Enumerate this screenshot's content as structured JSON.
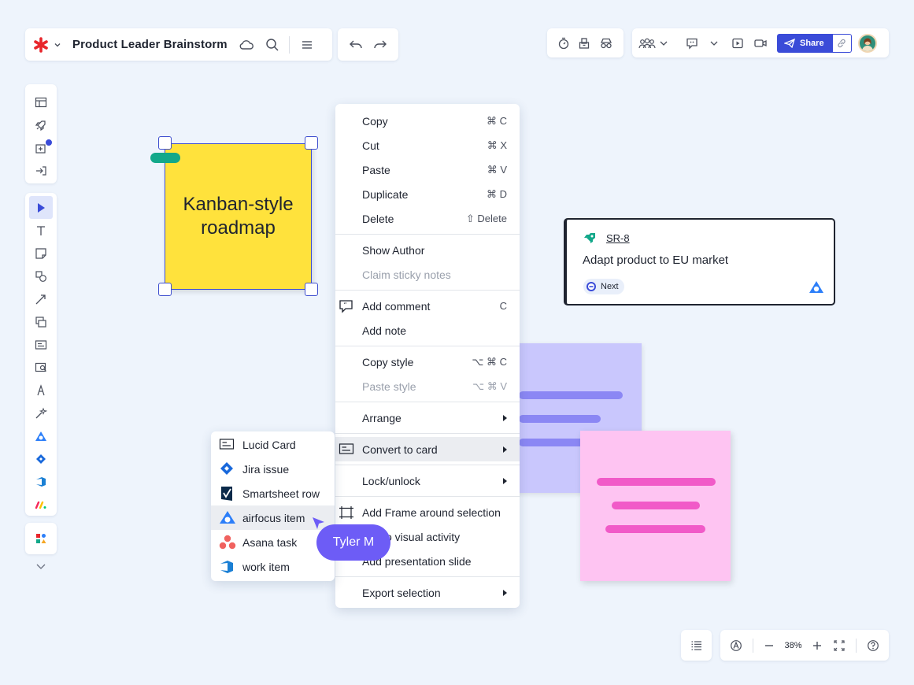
{
  "doc": {
    "title": "Product Leader Brainstorm"
  },
  "share": {
    "label": "Share"
  },
  "canvas": {
    "yellow_note": {
      "text": "Kanban-style roadmap",
      "color": "#ffe23c"
    },
    "lavender_note": {
      "color": "#c9c7fd"
    },
    "pink_note": {
      "color": "#fec4f2"
    },
    "airfocus_card": {
      "key": "SR-8",
      "title": "Adapt product to EU market",
      "status": "Next"
    }
  },
  "context_menu": {
    "items": [
      {
        "label": "Copy",
        "shortcut": "⌘ C"
      },
      {
        "label": "Cut",
        "shortcut": "⌘ X"
      },
      {
        "label": "Paste",
        "shortcut": "⌘ V"
      },
      {
        "label": "Duplicate",
        "shortcut": "⌘ D"
      },
      {
        "label": "Delete",
        "shortcut": "⇧ Delete"
      },
      {
        "label": "Show Author"
      },
      {
        "label": "Claim sticky notes"
      },
      {
        "label": "Add comment",
        "shortcut": "C"
      },
      {
        "label": "Add note"
      },
      {
        "label": "Copy style",
        "shortcut": "⌥ ⌘ C"
      },
      {
        "label": "Paste style",
        "shortcut": "⌥ ⌘ V"
      },
      {
        "label": "Arrange"
      },
      {
        "label": "Convert to card"
      },
      {
        "label": "Lock/unlock"
      },
      {
        "label": "Add Frame around selection"
      },
      {
        "label": "o visual activity"
      },
      {
        "label": "Add presentation slide"
      },
      {
        "label": "Export selection"
      }
    ]
  },
  "convert_submenu": {
    "items": [
      {
        "label": "Lucid Card"
      },
      {
        "label": "Jira issue"
      },
      {
        "label": "Smartsheet row"
      },
      {
        "label": "airfocus item"
      },
      {
        "label": "Asana task"
      },
      {
        "label": "work item"
      }
    ]
  },
  "cursor": {
    "user": "Tyler M",
    "color": "#6d5cf6"
  },
  "zoom": {
    "value": "38%"
  },
  "colors": {
    "accent": "#3a4bd8",
    "selection": "#3f4fcf",
    "background": "#eef4fc"
  }
}
